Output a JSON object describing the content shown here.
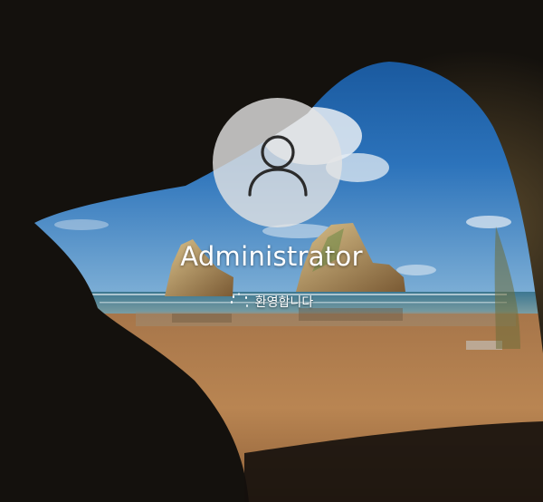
{
  "login": {
    "username": "Administrator",
    "status_text": "환영합니다",
    "avatar_icon": "user-icon",
    "spinner_icon": "loading-spinner-icon"
  },
  "background": {
    "scene": "sea-cave-beach-wallpaper",
    "colors": {
      "sky": "#1e5fa8",
      "sea": "#4a7f96",
      "sand": "#b07a48",
      "cave": "#0f0d0b"
    }
  }
}
